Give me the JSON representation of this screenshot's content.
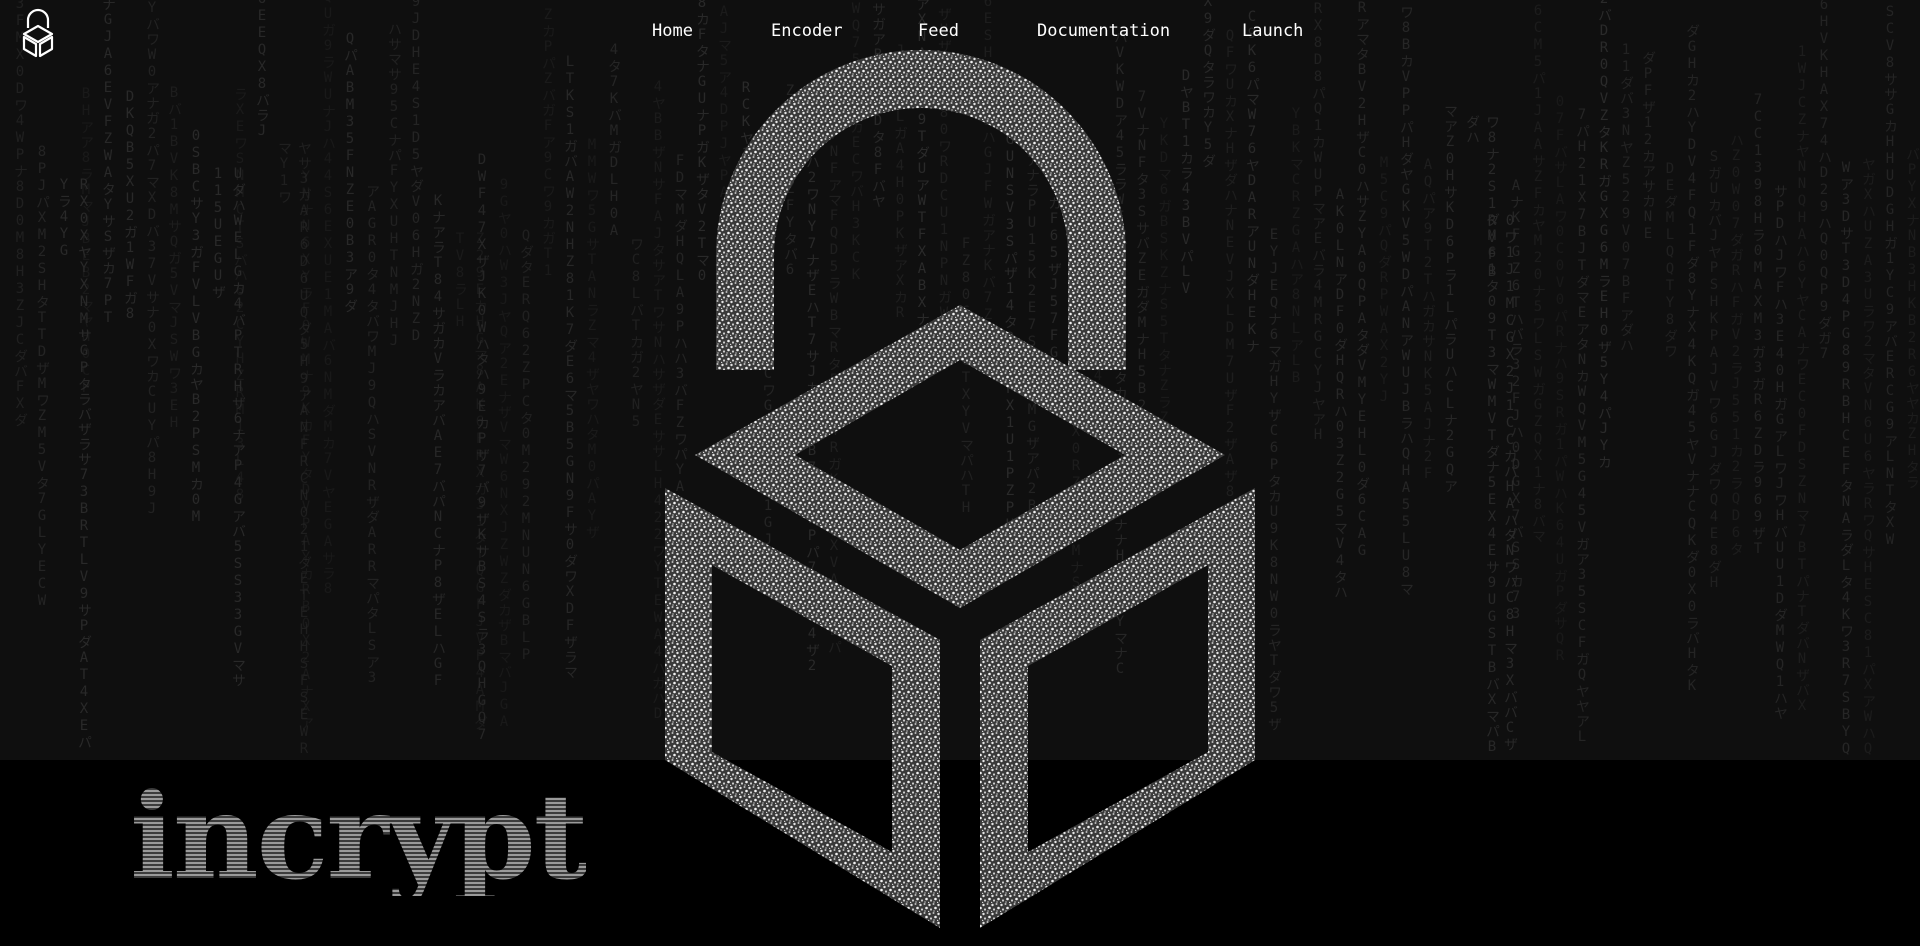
{
  "brand": {
    "logo_icon": "lock-cube-icon",
    "wordmark": "incrypt"
  },
  "nav": {
    "items": [
      {
        "label": "Home"
      },
      {
        "label": "Encoder"
      },
      {
        "label": "Feed"
      },
      {
        "label": "Documentation"
      },
      {
        "label": "Launch"
      }
    ]
  },
  "hero": {
    "illustration": "padlock-cube-icon"
  },
  "colors": {
    "background": "#0a0a0a",
    "rain": "#2b2b2b",
    "nav_text": "#ffffff",
    "particles": "#d8d8d8"
  }
}
